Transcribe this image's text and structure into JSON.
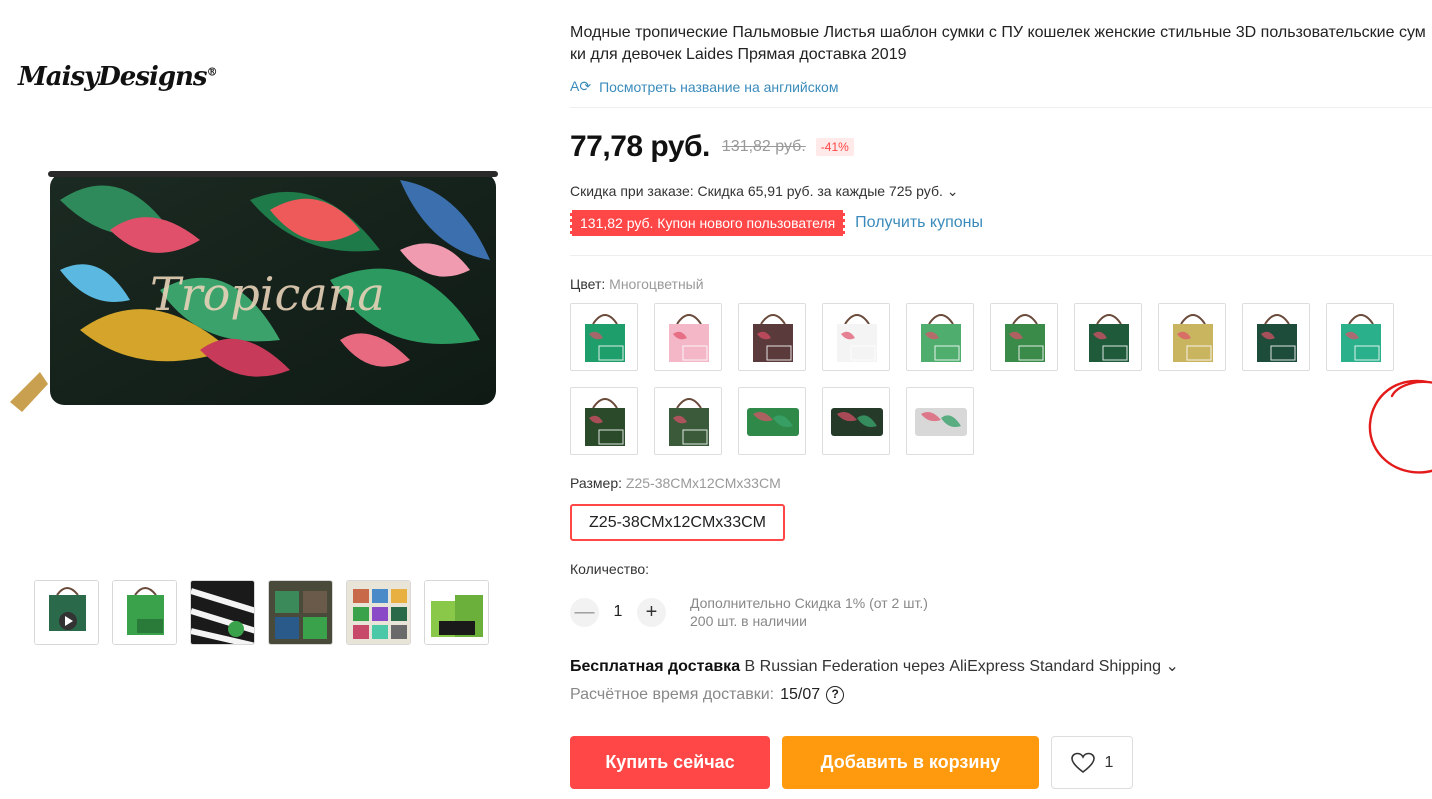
{
  "brand": {
    "name": "MaisyDesigns",
    "reg": "®",
    "product_text": "Tropicana"
  },
  "product": {
    "title": "Модные тропические Пальмовые Листья шаблон сумки с ПУ кошелек женские стильные 3D пользовательские сумки для девочек Laides Прямая доставка 2019",
    "translate_link": "Посмотреть название на английском",
    "translate_icon": "translate-icon"
  },
  "price": {
    "current": "77,78 руб.",
    "original": "131,82 руб.",
    "discount": "-41%",
    "order_discount": "Скидка при заказе: Скидка 65,91 руб. за каждые 725 руб. ⌄",
    "coupon": "131,82 руб. Купон нового пользователя",
    "get_coupons": "Получить купоны"
  },
  "color": {
    "label": "Цвет:",
    "value": "Многоцветный",
    "options": [
      {
        "bg": "#1e9e6b",
        "style": "tote"
      },
      {
        "bg": "#f4b7c8",
        "style": "tote"
      },
      {
        "bg": "#5a3a3a",
        "style": "tote"
      },
      {
        "bg": "#f4f4f4",
        "style": "tote"
      },
      {
        "bg": "#4fae6e",
        "style": "tote"
      },
      {
        "bg": "#3a8a4a",
        "style": "tote"
      },
      {
        "bg": "#1f5a3a",
        "style": "tote"
      },
      {
        "bg": "#c9b460",
        "style": "tote"
      },
      {
        "bg": "#1d4d3a",
        "style": "tote"
      },
      {
        "bg": "#2ab08a",
        "style": "tote"
      },
      {
        "bg": "#2a4a2a",
        "style": "tote"
      },
      {
        "bg": "#3a5a3a",
        "style": "tote"
      },
      {
        "bg": "#2f8a4a",
        "style": "wallet"
      },
      {
        "bg": "#263a2a",
        "style": "wallet"
      },
      {
        "bg": "#d8d8d8",
        "style": "wallet"
      }
    ],
    "selected_index": 13
  },
  "size": {
    "label": "Размер:",
    "value": "Z25-38CMx12CMx33CM",
    "option": "Z25-38CMx12CMx33CM"
  },
  "quantity": {
    "label": "Количество:",
    "value": "1",
    "minus": "—",
    "plus": "+",
    "extra_discount": "Дополнительно Скидка 1% (от 2 шт.)",
    "stock": "200 шт. в наличии"
  },
  "shipping": {
    "free": "Бесплатная доставка",
    "details": "В Russian Federation через AliExpress Standard Shipping ⌄",
    "eta_label": "Расчётное время доставки:",
    "eta_date": "15/07",
    "help": "?"
  },
  "actions": {
    "buy": "Купить сейчас",
    "cart": "Добавить в корзину",
    "wish_count": "1"
  },
  "colors": {
    "accent": "#ff4747",
    "cart": "#ff9a0e",
    "link": "#3a8bbb"
  }
}
